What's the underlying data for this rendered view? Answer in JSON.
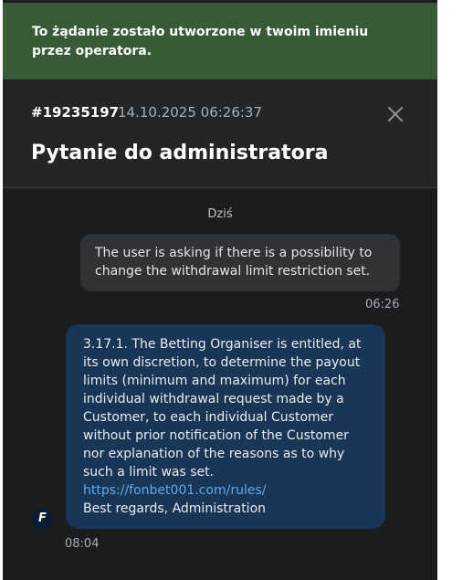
{
  "banner": {
    "text": "To żądanie zostało utworzone w twoim imieniu przez operatora."
  },
  "ticket": {
    "id": "#19235197",
    "datetime": "14.10.2025 06:26:37",
    "title": "Pytanie do administratora",
    "close_icon": "close-icon"
  },
  "chat": {
    "day_separator": "Dziś",
    "messages": [
      {
        "sender": "user",
        "text": "The user is asking if there is a possibility to change the withdrawal limit restriction set.",
        "time": "06:26"
      },
      {
        "sender": "admin",
        "avatar_letter": "F",
        "text": "3.17.1. The Betting Organiser is entitled, at its own discretion, to determine the payout limits (minimum and maximum) for each individual withdrawal request made by a Customer, to each individual Customer without prior notification of the Customer nor explanation of the reasons as to why such a limit was set.",
        "link": "https://fonbet001.com/rules/",
        "signature": "Best regards, Administration",
        "time": "08:04"
      }
    ]
  },
  "colors": {
    "banner_bg": "#385a37",
    "panel_bg": "#1a1c1e",
    "header_bg": "#232527",
    "user_bubble_bg": "#2f3236",
    "admin_bubble_bg": "#193656",
    "link": "#63a7e6"
  }
}
